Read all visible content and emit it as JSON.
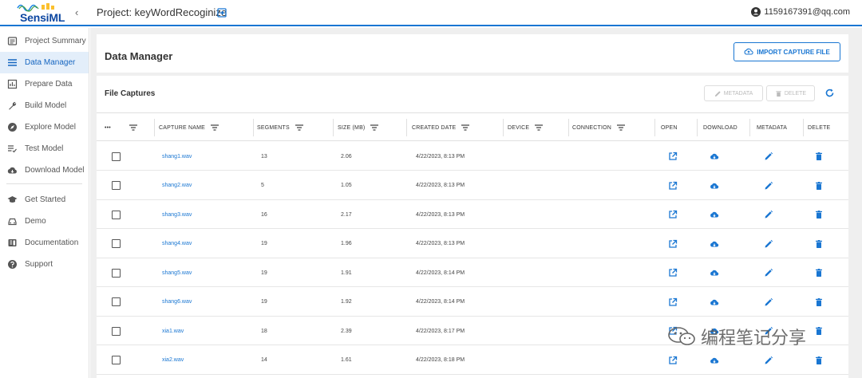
{
  "app": {
    "brand": "SensiML",
    "project_label": "Project: keyWordRecoginize",
    "user_email": "1159167391@qq.com"
  },
  "sidebar": {
    "primary": [
      {
        "label": "Project Summary",
        "icon": "project-summary-icon",
        "active": false
      },
      {
        "label": "Data Manager",
        "icon": "list-icon",
        "active": true
      },
      {
        "label": "Prepare Data",
        "icon": "prepare-data-icon",
        "active": false
      },
      {
        "label": "Build Model",
        "icon": "wrench-icon",
        "active": false
      },
      {
        "label": "Explore Model",
        "icon": "compass-icon",
        "active": false
      },
      {
        "label": "Test Model",
        "icon": "test-list-icon",
        "active": false
      },
      {
        "label": "Download Model",
        "icon": "cloud-download-icon",
        "active": false
      }
    ],
    "secondary": [
      {
        "label": "Get Started",
        "icon": "graduation-cap-icon"
      },
      {
        "label": "Demo",
        "icon": "car-icon"
      },
      {
        "label": "Documentation",
        "icon": "book-icon"
      },
      {
        "label": "Support",
        "icon": "help-icon"
      }
    ]
  },
  "page": {
    "title": "Data Manager",
    "import_label": "IMPORT CAPTURE FILE"
  },
  "captures": {
    "title": "File Captures",
    "metadata_label": "METADATA",
    "delete_label": "DELETE",
    "columns": {
      "capture_name": "CAPTURE NAME",
      "segments": "SEGMENTS",
      "size": "SIZE (MB)",
      "created": "CREATED DATE",
      "device": "DEVICE",
      "connection": "CONNECTION",
      "open": "OPEN",
      "download": "DOWNLOAD",
      "metadata": "METADATA",
      "delete": "DELETE",
      "more": "•••"
    },
    "rows": [
      {
        "name": "shang1.wav",
        "segments": "13",
        "size": "2.06",
        "created": "4/22/2023, 8:13 PM"
      },
      {
        "name": "shang2.wav",
        "segments": "5",
        "size": "1.05",
        "created": "4/22/2023, 8:13 PM"
      },
      {
        "name": "shang3.wav",
        "segments": "16",
        "size": "2.17",
        "created": "4/22/2023, 8:13 PM"
      },
      {
        "name": "shang4.wav",
        "segments": "19",
        "size": "1.96",
        "created": "4/22/2023, 8:13 PM"
      },
      {
        "name": "shang5.wav",
        "segments": "19",
        "size": "1.91",
        "created": "4/22/2023, 8:14 PM"
      },
      {
        "name": "shang6.wav",
        "segments": "19",
        "size": "1.92",
        "created": "4/22/2023, 8:14 PM"
      },
      {
        "name": "xia1.wav",
        "segments": "18",
        "size": "2.39",
        "created": "4/22/2023, 8:17 PM"
      },
      {
        "name": "xia2.wav",
        "segments": "14",
        "size": "1.61",
        "created": "4/22/2023, 8:18 PM"
      }
    ]
  },
  "watermark": {
    "text": "编程笔记分享"
  },
  "colors": {
    "accent": "#1976d2",
    "brand": "#0d47a1",
    "active_bg": "#e3eefa"
  }
}
